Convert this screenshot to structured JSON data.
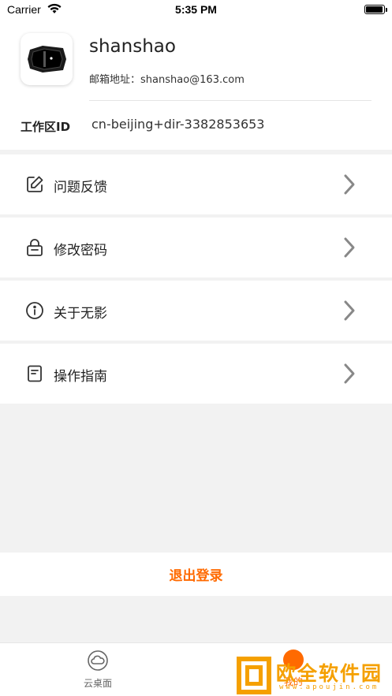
{
  "status_bar": {
    "carrier": "Carrier",
    "time": "5:35 PM"
  },
  "profile": {
    "username": "shanshao",
    "email_label": "邮箱地址：",
    "email": "shanshao@163.com",
    "workspace_label": "工作区ID",
    "workspace_id": "cn-beijing+dir-3382853653"
  },
  "menu": {
    "items": [
      {
        "label": "问题反馈",
        "icon": "edit-icon"
      },
      {
        "label": "修改密码",
        "icon": "lock-icon"
      },
      {
        "label": "关于无影",
        "icon": "info-icon"
      },
      {
        "label": "操作指南",
        "icon": "document-icon"
      }
    ]
  },
  "logout": {
    "label": "退出登录"
  },
  "tabbar": {
    "tabs": [
      {
        "label": "云桌面",
        "icon": "cloud-icon"
      },
      {
        "label": "我的",
        "icon": "person-icon"
      }
    ],
    "accent": "#ff6a00"
  },
  "watermark": {
    "text": "欧全软件园",
    "url": "www.apoujin.com"
  }
}
